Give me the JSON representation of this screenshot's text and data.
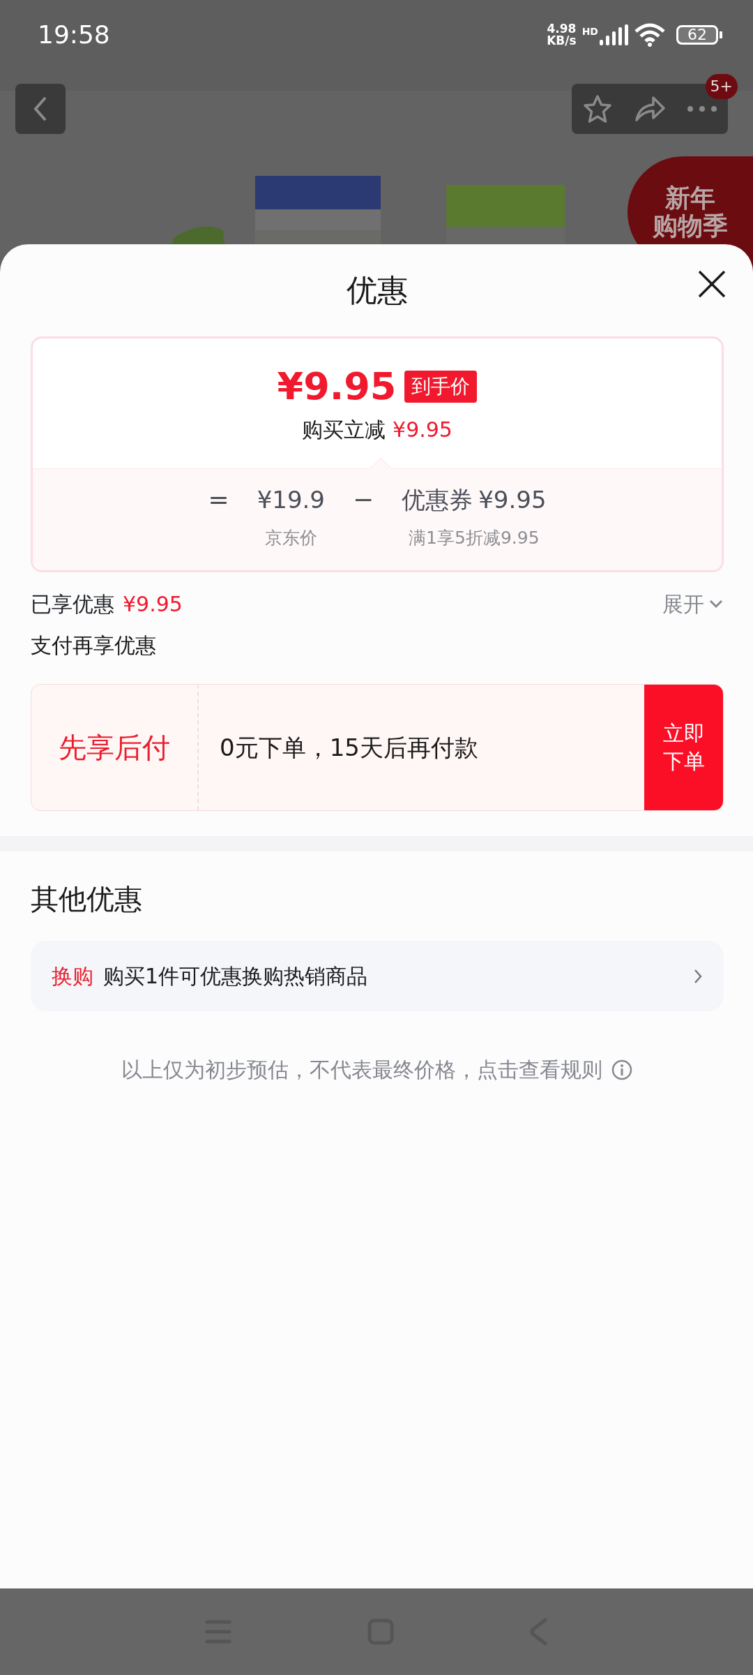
{
  "status_bar": {
    "time": "19:58",
    "net_speed": "4.98",
    "net_unit": "KB/s",
    "signal_tag": "HD",
    "battery": "62"
  },
  "toolbar": {
    "badge": "5+"
  },
  "promo_tag": {
    "lines": [
      "新年",
      "购物季"
    ]
  },
  "sheet": {
    "title": "优惠"
  },
  "price_card": {
    "price": "¥9.95",
    "price_tag": "到手价",
    "instant_label": "购买立减",
    "instant_amount": "¥9.95",
    "formula": [
      {
        "kind": "operator",
        "text": "="
      },
      {
        "kind": "term",
        "value": "¥19.9",
        "caption": "京东价"
      },
      {
        "kind": "operator",
        "text": "−"
      },
      {
        "kind": "term",
        "label": "优惠券",
        "value": "¥9.95",
        "caption": "满1享5折减9.95"
      }
    ]
  },
  "discount": {
    "label": "已享优惠",
    "amount": "¥9.95",
    "toggle": "展开",
    "expanded": false
  },
  "pay_section": {
    "title": "支付再享优惠",
    "offer": {
      "name": "先享后付",
      "description": "0元下单，15天后再付款",
      "button": "立即下单"
    }
  },
  "other": {
    "title": "其他优惠",
    "items": [
      {
        "tag": "换购",
        "text": "购买1件可优惠换购热销商品"
      }
    ]
  },
  "note": "以上仅为初步预估，不代表最终价格，点击查看规则"
}
